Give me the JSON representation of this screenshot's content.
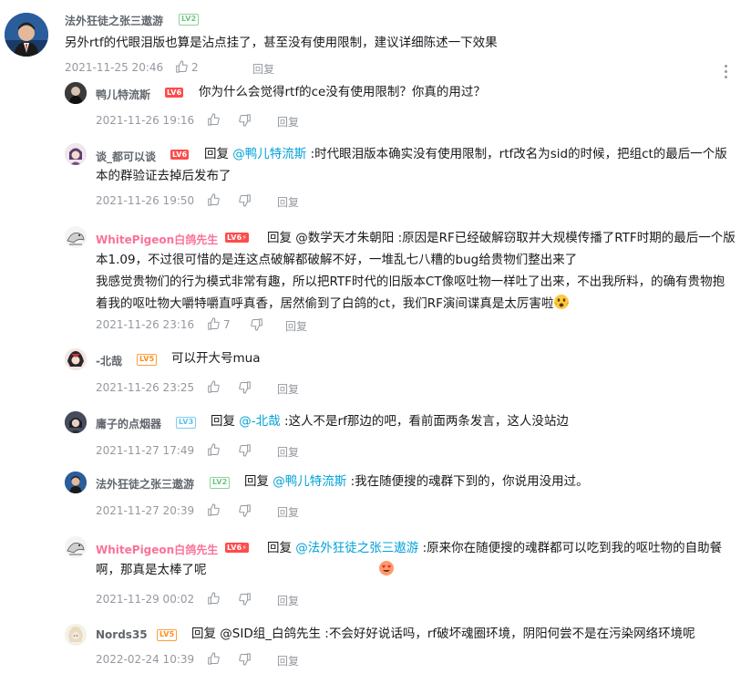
{
  "main_comment": {
    "user": "法外狂徒之张三遨游",
    "level": "LV2",
    "text": "另外rtf的代眼泪版也算是沾点挂了，甚至没有使用限制，建议详细陈述一下效果",
    "time": "2021-11-25 20:46",
    "likes": "2",
    "reply_label": "回复"
  },
  "replies": [
    {
      "user": "鸭儿特流斯",
      "level": "LV6",
      "reply_kw": "",
      "at": "",
      "text": "你为什么会觉得rtf的ce没有使用限制？你真的用过？",
      "time": "2021-11-26 19:16",
      "likes": "",
      "reply_label": "回复"
    },
    {
      "user": "谈_都可以谈",
      "level": "LV6",
      "reply_kw": "回复",
      "at": "@鸭儿特流斯",
      "text": ":时代眼泪版本确实没有使用限制，rtf改名为sid的时候，把组ct的最后一个版本的群验证去掉后发布了",
      "time": "2021-11-26 19:50",
      "likes": "",
      "reply_label": "回复"
    },
    {
      "user": "WhitePigeon白鸽先生",
      "level": "LV6⚡",
      "reply_kw": "回复",
      "at": "@数学天才朱朝阳",
      "text": ":原因是RF已经破解窃取并大规模传播了RTF时期的最后一个版本1.09，不过很可惜的是连这点破解都破解不好，一堆乱七八糟的bug给贵物们整出来了",
      "text2": "我感觉贵物们的行为模式非常有趣，所以把RTF时代的旧版本CT像呕吐物一样吐了出来，不出我所料，的确有贵物抱着我的呕吐物大嚼特嚼直呼真香，居然偷到了白鸽的ct，我们RF演间谍真是太厉害啦",
      "time": "2021-11-26 23:16",
      "likes": "7",
      "reply_label": "回复"
    },
    {
      "user": "-北哉",
      "level": "LV5",
      "reply_kw": "",
      "at": "",
      "text": "可以开大号mua",
      "time": "2021-11-26 23:25",
      "likes": "",
      "reply_label": "回复"
    },
    {
      "user": "庸子的点烟器",
      "level": "LV3",
      "reply_kw": "回复",
      "at": "@-北哉",
      "text": ":这人不是rf那边的吧，看前面两条发言，这人没站边",
      "time": "2021-11-27 17:49",
      "likes": "",
      "reply_label": "回复"
    },
    {
      "user": "法外狂徒之张三遨游",
      "level": "LV2",
      "reply_kw": "回复",
      "at": "@鸭儿特流斯",
      "text": ":我在随便搜的魂群下到的，你说用没用过。",
      "time": "2021-11-27 20:39",
      "likes": "",
      "reply_label": "回复"
    },
    {
      "user": "WhitePigeon白鸽先生",
      "level": "LV6⚡",
      "reply_kw": "回复",
      "at": "@法外狂徒之张三遨游",
      "text": ":原来你在随便搜的魂群都可以吃到我的呕吐物的自助餐啊，那真是太棒了呢",
      "time": "2021-11-29 00:02",
      "likes": "",
      "reply_label": "回复"
    },
    {
      "user": "Nords35",
      "level": "LV5",
      "reply_kw": "回复",
      "at": "@SID组_白鸽先生",
      "text": ":不会好好说话吗，rf破坏魂圈环境，阴阳何尝不是在污染网络环境呢",
      "time": "2022-02-24 10:39",
      "likes": "",
      "reply_label": "回复"
    }
  ]
}
